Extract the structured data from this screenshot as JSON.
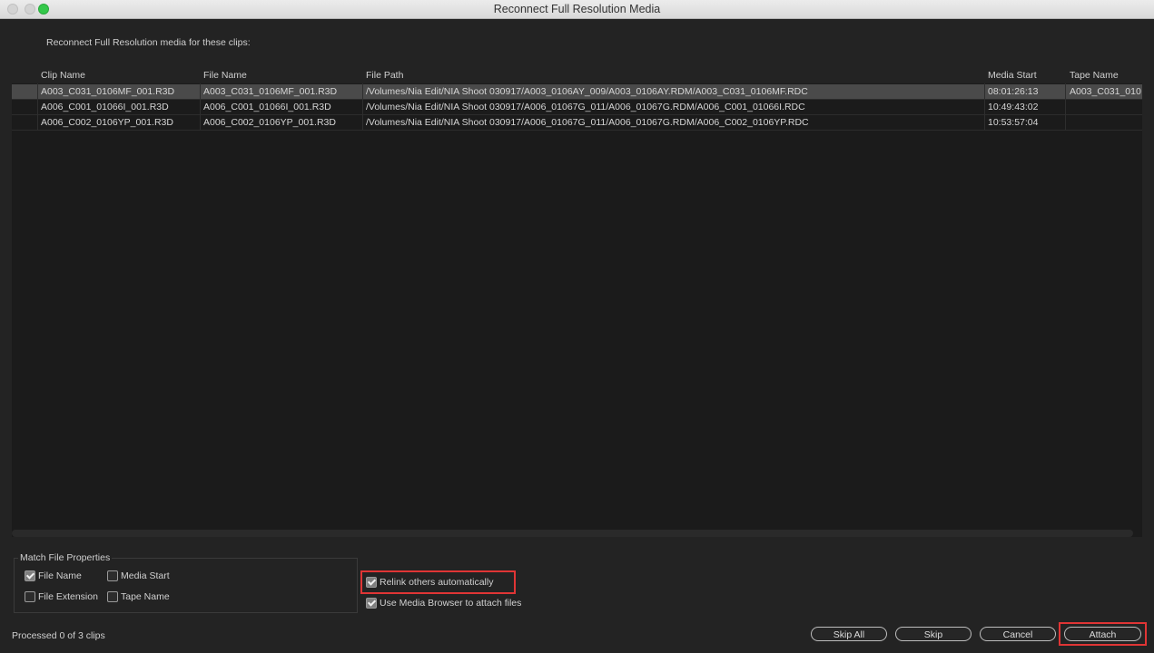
{
  "window": {
    "title": "Reconnect Full Resolution Media"
  },
  "intro_text": "Reconnect Full Resolution media for these clips:",
  "table": {
    "columns": [
      "Clip Name",
      "File Name",
      "File Path",
      "Media Start",
      "Tape Name"
    ],
    "rows": [
      {
        "clip_name": "A003_C031_0106MF_001.R3D",
        "file_name": "A003_C031_0106MF_001.R3D",
        "file_path": "/Volumes/Nia Edit/NIA Shoot 030917/A003_0106AY_009/A003_0106AY.RDM/A003_C031_0106MF.RDC",
        "media_start": "08:01:26:13",
        "tape_name": "A003_C031_010"
      },
      {
        "clip_name": "A006_C001_01066I_001.R3D",
        "file_name": "A006_C001_01066I_001.R3D",
        "file_path": "/Volumes/Nia Edit/NIA Shoot 030917/A006_01067G_011/A006_01067G.RDM/A006_C001_01066I.RDC",
        "media_start": "10:49:43:02",
        "tape_name": ""
      },
      {
        "clip_name": "A006_C002_0106YP_001.R3D",
        "file_name": "A006_C002_0106YP_001.R3D",
        "file_path": "/Volumes/Nia Edit/NIA Shoot 030917/A006_01067G_011/A006_01067G.RDM/A006_C002_0106YP.RDC",
        "media_start": "10:53:57:04",
        "tape_name": ""
      }
    ]
  },
  "match_properties": {
    "title": "Match File Properties",
    "file_name": {
      "label": "File Name",
      "checked": true
    },
    "media_start": {
      "label": "Media Start",
      "checked": false
    },
    "file_extension": {
      "label": "File Extension",
      "checked": false
    },
    "tape_name": {
      "label": "Tape Name",
      "checked": false
    }
  },
  "options": {
    "relink": {
      "label": "Relink others automatically",
      "checked": true
    },
    "media_browser": {
      "label": "Use Media Browser to attach files",
      "checked": true
    }
  },
  "status_text": "Processed 0 of 3 clips",
  "buttons": {
    "skip_all": "Skip All",
    "skip": "Skip",
    "cancel": "Cancel",
    "attach": "Attach"
  },
  "colors": {
    "highlight": "#e03535",
    "selected_row": "#4a4a4a"
  }
}
